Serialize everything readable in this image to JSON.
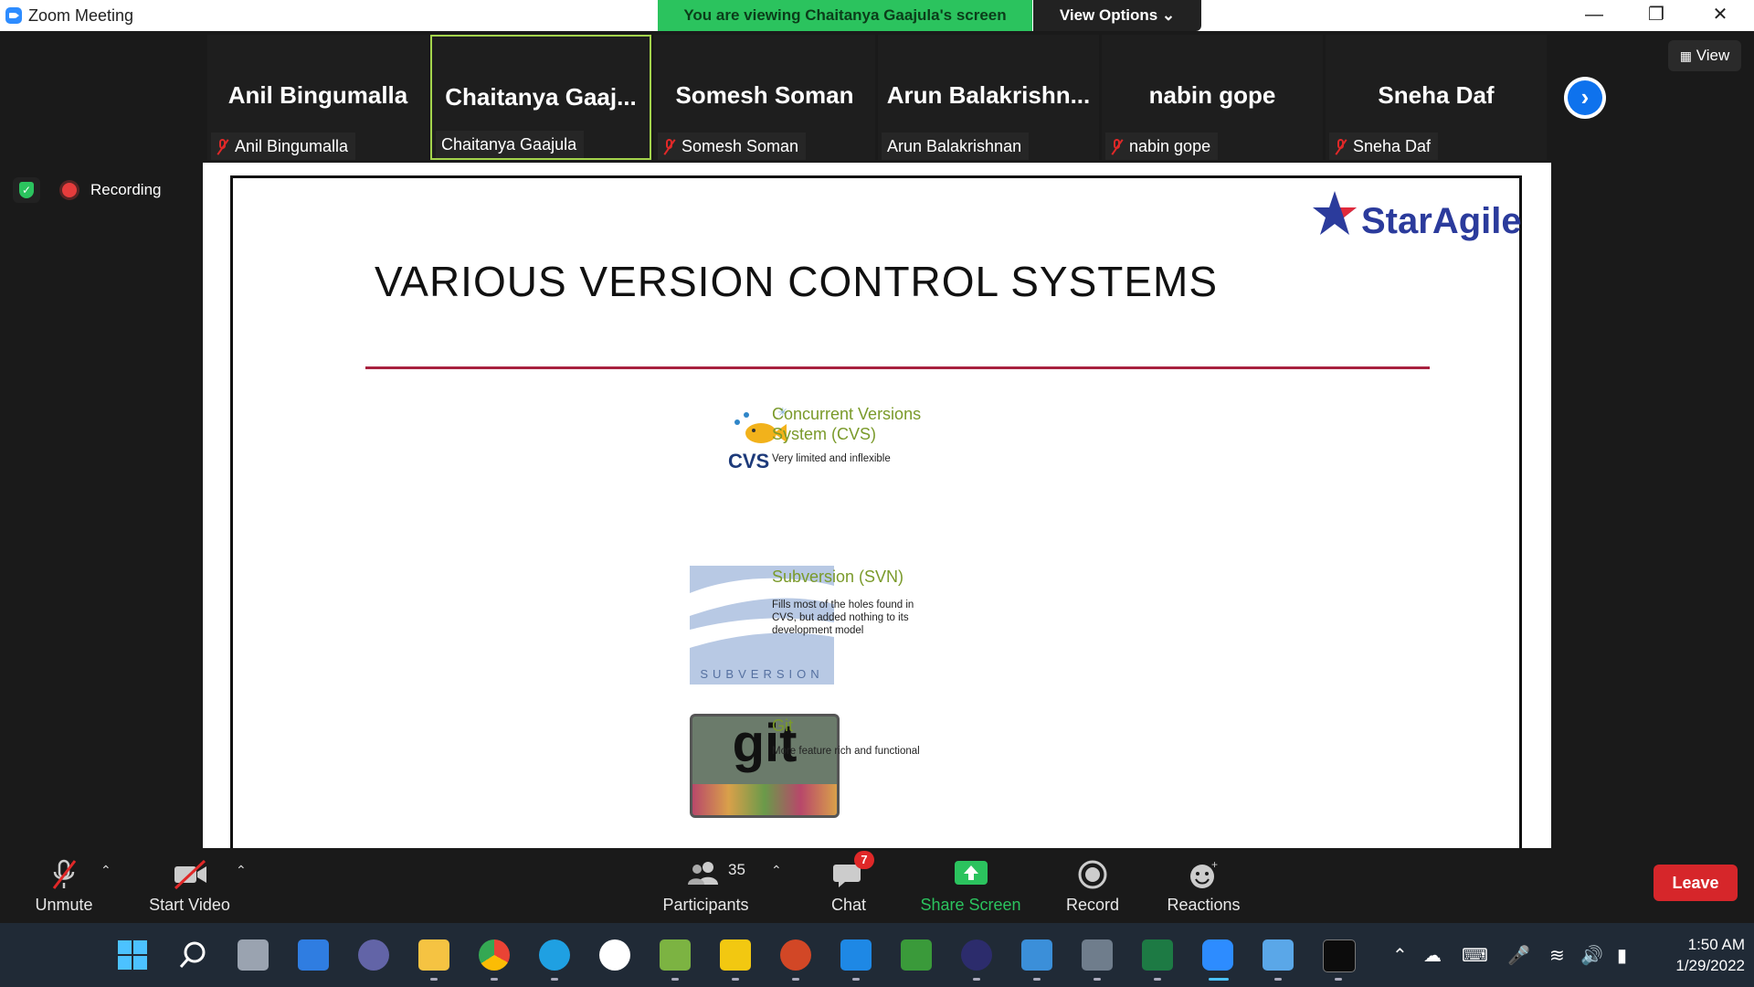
{
  "window": {
    "title": "Zoom Meeting"
  },
  "banner": {
    "viewing": "You are viewing Chaitanya Gaajula's screen",
    "view_options": "View Options ⌄"
  },
  "participants_strip": [
    {
      "display": "Anil Bingumalla",
      "tag": "Anil Bingumalla",
      "muted": true,
      "active": false
    },
    {
      "display": "Chaitanya  Gaaj...",
      "tag": "Chaitanya Gaajula",
      "muted": false,
      "active": true
    },
    {
      "display": "Somesh Soman",
      "tag": "Somesh Soman",
      "muted": true,
      "active": false
    },
    {
      "display": "Arun  Balakrishn...",
      "tag": "Arun Balakrishnan",
      "muted": false,
      "active": false
    },
    {
      "display": "nabin gope",
      "tag": "nabin gope",
      "muted": true,
      "active": false
    },
    {
      "display": "Sneha Daf",
      "tag": "Sneha Daf",
      "muted": true,
      "active": false
    }
  ],
  "view_button": "View",
  "recording": {
    "label": "Recording"
  },
  "slide": {
    "title": "VARIOUS VERSION CONTROL SYSTEMS",
    "logo": "StarAgile",
    "items": [
      {
        "name": "Concurrent Versions System (CVS)",
        "desc": "Very limited and inflexible",
        "logo_text": "CVS"
      },
      {
        "name": "Subversion (SVN)",
        "desc": "Fills most of the holes found in CVS, but added nothing to its development model",
        "logo_text": "SUBVERSION"
      },
      {
        "name": "Git",
        "desc": "More feature rich and functional",
        "logo_text": "git"
      }
    ]
  },
  "toolbar": {
    "unmute": "Unmute",
    "start_video": "Start Video",
    "participants": "Participants",
    "participants_count": "35",
    "chat": "Chat",
    "chat_badge": "7",
    "share_screen": "Share Screen",
    "record": "Record",
    "reactions": "Reactions",
    "leave": "Leave"
  },
  "taskbar": {
    "time": "1:50 AM",
    "date": "1/29/2022"
  },
  "colors": {
    "accent": "#2D8CFF",
    "share_green": "#2BC35E",
    "leave_red": "#d6262a",
    "slide_rule": "#a8213f"
  }
}
